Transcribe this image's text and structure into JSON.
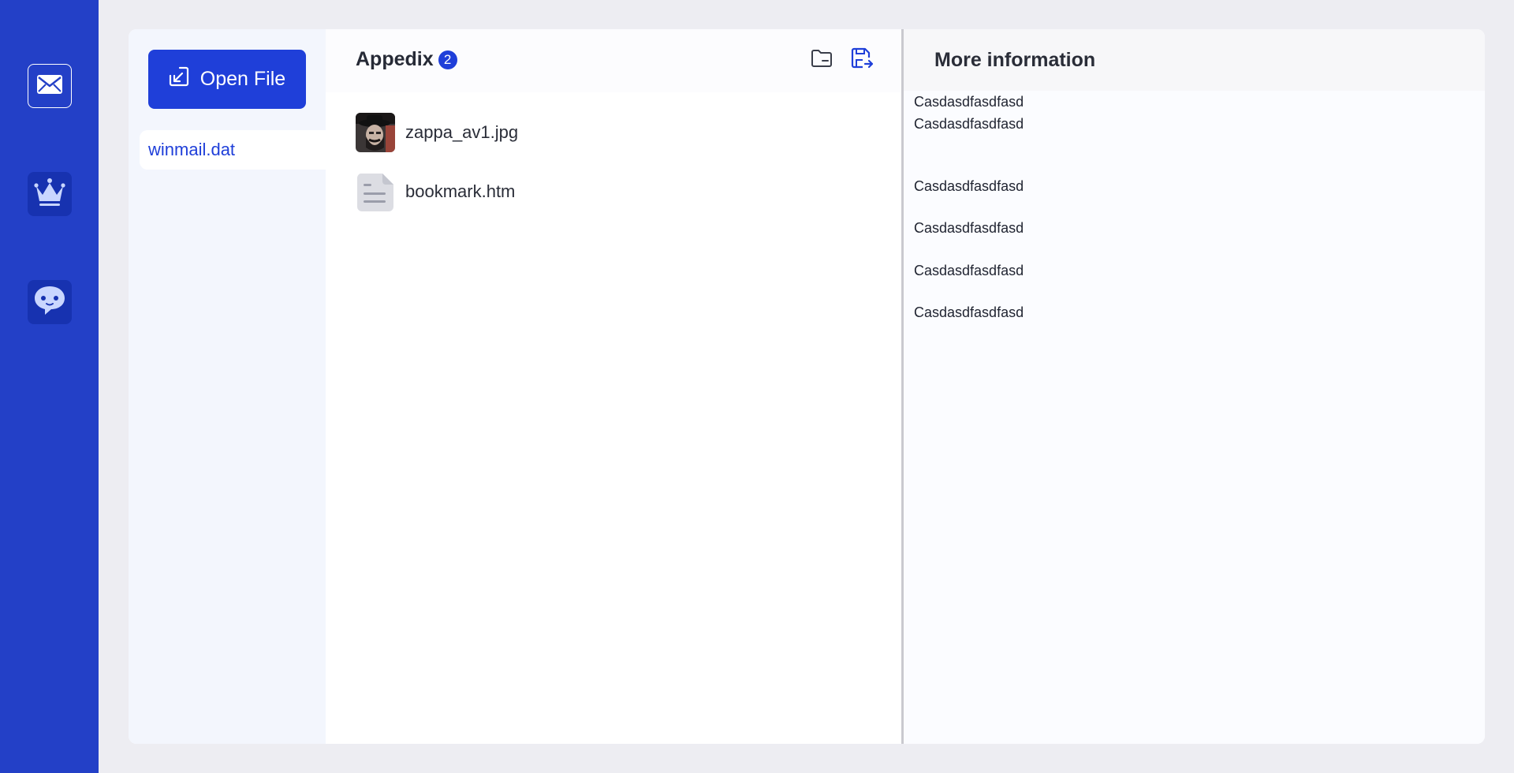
{
  "rail": {
    "items": [
      {
        "name": "mail",
        "icon": "mail-icon"
      },
      {
        "name": "premium",
        "icon": "crown-icon"
      },
      {
        "name": "support",
        "icon": "chat-bot-icon"
      }
    ]
  },
  "files": {
    "open_button_label": "Open File",
    "open_button_icon": "open-file-icon",
    "items": [
      {
        "label": "winmail.dat",
        "selected": true
      }
    ]
  },
  "attachments": {
    "title": "Appedix",
    "count": "2",
    "actions": [
      {
        "name": "open-folder",
        "icon": "folder-icon"
      },
      {
        "name": "save-as",
        "icon": "save-export-icon"
      }
    ],
    "items": [
      {
        "name": "zappa_av1.jpg",
        "icon": "image-thumbnail"
      },
      {
        "name": "bookmark.htm",
        "icon": "document-icon"
      }
    ]
  },
  "info": {
    "title": "More information",
    "lines": [
      "Casdasdfasdfasd",
      "Casdasdfasdfasd",
      "Casdasdfasdfasd",
      "Casdasdfasdfasd",
      "Casdasdfasdfasd",
      "Casdasdfasdfasd"
    ]
  },
  "colors": {
    "rail": "#2340c7",
    "accent": "#1f3fd9",
    "background": "#ededf2"
  }
}
